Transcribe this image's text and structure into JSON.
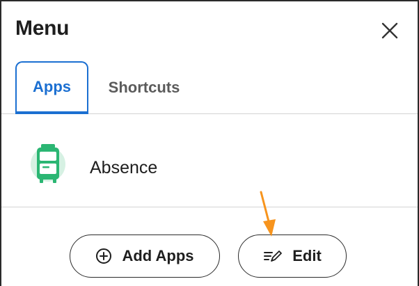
{
  "header": {
    "title": "Menu",
    "close_icon": "close-icon"
  },
  "tabs": [
    {
      "label": "Apps",
      "selected": true
    },
    {
      "label": "Shortcuts",
      "selected": false
    }
  ],
  "apps": [
    {
      "label": "Absence",
      "icon": "luggage-icon"
    }
  ],
  "footer": {
    "add_apps_label": "Add Apps",
    "add_apps_icon": "plus-circle-icon",
    "edit_label": "Edit",
    "edit_icon": "edit-list-icon"
  },
  "annotation": {
    "icon": "arrow-pointer",
    "color": "#f7941d"
  },
  "colors": {
    "accent": "#1b6fd1",
    "app_icon_green": "#2bb673",
    "app_icon_bg": "#d6f1e3"
  }
}
